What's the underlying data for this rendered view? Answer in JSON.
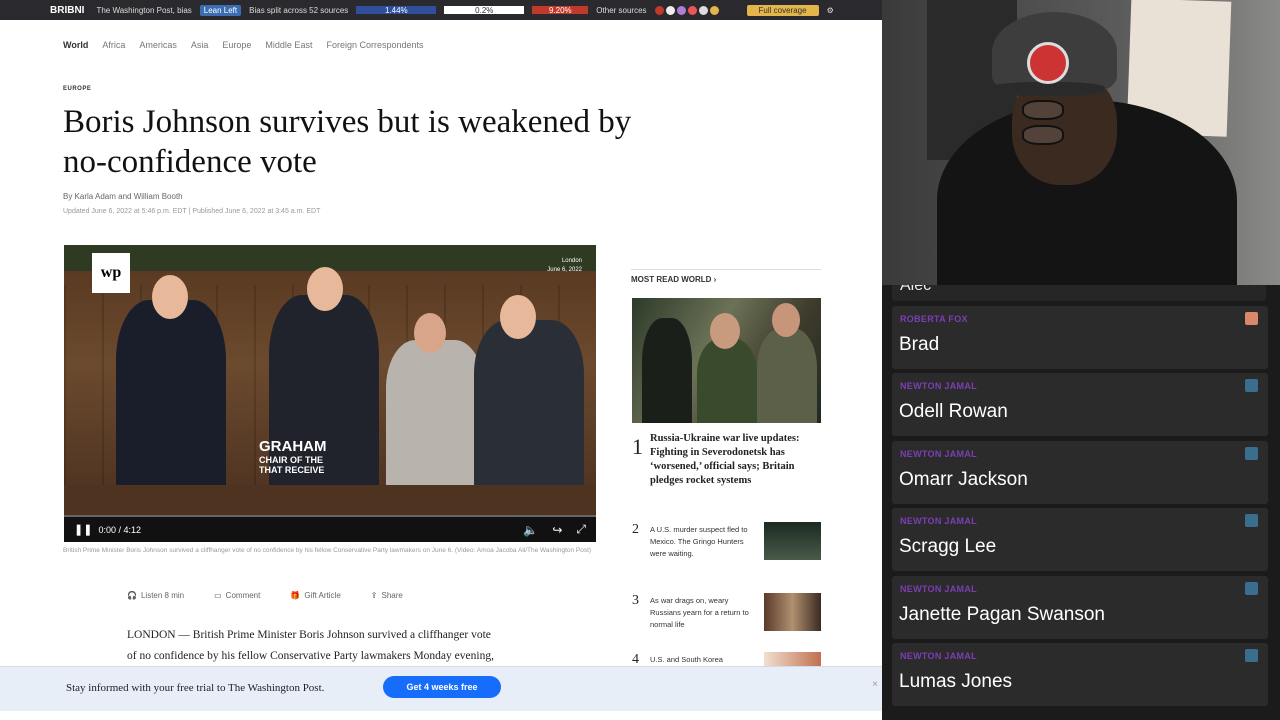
{
  "topbar": {
    "brand": "BRIBNI",
    "tab_title": "The Washington Post, bias",
    "bias_pill": "Lean Left",
    "bias_sources": "Bias split across 52 sources",
    "bias_values": [
      "1.44%",
      "0.2%",
      "9.20%"
    ],
    "other_sources": "Other sources",
    "cta": "Full coverage",
    "colors": {
      "left": "#2f4f9c",
      "center": "#ffffff",
      "right": "#c0392b"
    }
  },
  "article": {
    "nav": [
      "World",
      "Africa",
      "Americas",
      "Asia",
      "Europe",
      "Middle East",
      "Foreign Correspondents"
    ],
    "kicker": "EUROPE",
    "headline": "Boris Johnson survives but is weakened by no-confidence vote",
    "byline": "By Karla Adam and William Booth",
    "dates": "Updated June 6, 2022 at 5:46 p.m. EDT  |  Published June 6, 2022 at 3:45 a.m. EDT",
    "video": {
      "logo": "wp",
      "location": "London",
      "date": "June 6, 2022",
      "lower_third_name": "GRAHAM",
      "lower_third_title_1": "CHAIR OF THE",
      "lower_third_title_2": "THAT RECEIVE",
      "time": "0:00 / 4:12",
      "progress": 0.0
    },
    "caption": "British Prime Minister Boris Johnson survived a cliffhanger vote of no confidence by his fellow Conservative Party lawmakers on June 6. (Video: Amoa Jacoba Ali/The Washington Post)",
    "tools": [
      {
        "icon": "headphones-icon",
        "glyph": "🎧",
        "label": "Listen 8 min"
      },
      {
        "icon": "comment-icon",
        "glyph": "▭",
        "label": "Comment"
      },
      {
        "icon": "gift-icon",
        "glyph": "🎁",
        "label": "Gift Article"
      },
      {
        "icon": "share-icon",
        "glyph": "⇪",
        "label": "Share"
      }
    ],
    "body_1": "LONDON — British Prime Minister Boris Johnson survived a cliffhanger vote",
    "body_2": "of no confidence by his fellow Conservative Party lawmakers Monday evening,"
  },
  "most_read": {
    "heading": "MOST READ WORLD ›",
    "lead_num": "1",
    "lead_title": "Russia-Ukraine war live updates: Fighting in Severodonetsk has ‘worsened,’ official says; Britain pledges rocket systems",
    "items": [
      {
        "num": "2",
        "text": "A U.S. murder suspect fled to Mexico. The Gringo Hunters were waiting."
      },
      {
        "num": "3",
        "text": "As war drags on, weary Russians yearn for a return to normal life"
      },
      {
        "num": "4",
        "text": "U.S. and South Korea"
      }
    ]
  },
  "promo": {
    "text": "Stay informed with your free trial to The Washington Post.",
    "button": "Get 4 weeks free",
    "close": "×"
  },
  "chat": {
    "previous_name": "Alec",
    "cards": [
      {
        "role": "ROBERTA FOX",
        "name": "Brad",
        "color": "#d9896a"
      },
      {
        "role": "NEWTON JAMAL",
        "name": "Odell Rowan",
        "color": "#3b6d8f"
      },
      {
        "role": "NEWTON JAMAL",
        "name": "Omarr Jackson",
        "color": "#3b6d8f"
      },
      {
        "role": "NEWTON JAMAL",
        "name": "Scragg Lee",
        "color": "#3b6d8f"
      },
      {
        "role": "NEWTON JAMAL",
        "name": "Janette Pagan Swanson",
        "color": "#3b6d8f"
      },
      {
        "role": "NEWTON JAMAL",
        "name": "Lumas Jones",
        "color": "#3b6d8f"
      }
    ]
  }
}
